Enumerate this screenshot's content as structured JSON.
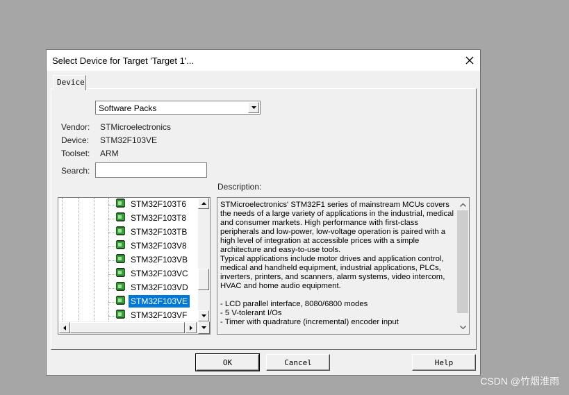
{
  "dialog": {
    "title": "Select Device for Target 'Target 1'..."
  },
  "tabs": [
    {
      "label": "Device"
    }
  ],
  "source_select": {
    "value": "Software Packs"
  },
  "info": {
    "vendor_label": "Vendor:",
    "vendor_value": "STMicroelectronics",
    "device_label": "Device:",
    "device_value": "STM32F103VE",
    "toolset_label": "Toolset:",
    "toolset_value": "ARM",
    "search_label": "Search:",
    "search_value": ""
  },
  "description": {
    "label": "Description:",
    "text": "STMicroelectronics' STM32F1 series of mainstream MCUs covers the needs of a large variety of applications in the industrial, medical and consumer markets. High performance with first-class peripherals and low-power, low-voltage operation is paired with a high level of integration at accessible prices with a simple architecture and easy-to-use tools.\nTypical applications include motor drives and application control, medical and handheld equipment, industrial applications, PLCs, inverters, printers, and scanners, alarm systems, video intercom, HVAC and home audio equipment.\n\n  - LCD parallel interface, 8080/6800 modes\n  - 5 V-tolerant I/Os\n  - Timer with quadrature (incremental) encoder input"
  },
  "device_tree": {
    "items": [
      {
        "label": "STM32F103T6",
        "selected": false
      },
      {
        "label": "STM32F103T8",
        "selected": false
      },
      {
        "label": "STM32F103TB",
        "selected": false
      },
      {
        "label": "STM32F103V8",
        "selected": false
      },
      {
        "label": "STM32F103VB",
        "selected": false
      },
      {
        "label": "STM32F103VC",
        "selected": false
      },
      {
        "label": "STM32F103VD",
        "selected": false
      },
      {
        "label": "STM32F103VE",
        "selected": true
      },
      {
        "label": "STM32F103VF",
        "selected": false
      }
    ]
  },
  "buttons": {
    "ok": "OK",
    "cancel": "Cancel",
    "help": "Help"
  },
  "watermark": "CSDN @竹烟淮雨",
  "colors": {
    "selection": "#0078d7",
    "chip_icon": "#3a9d3a"
  }
}
